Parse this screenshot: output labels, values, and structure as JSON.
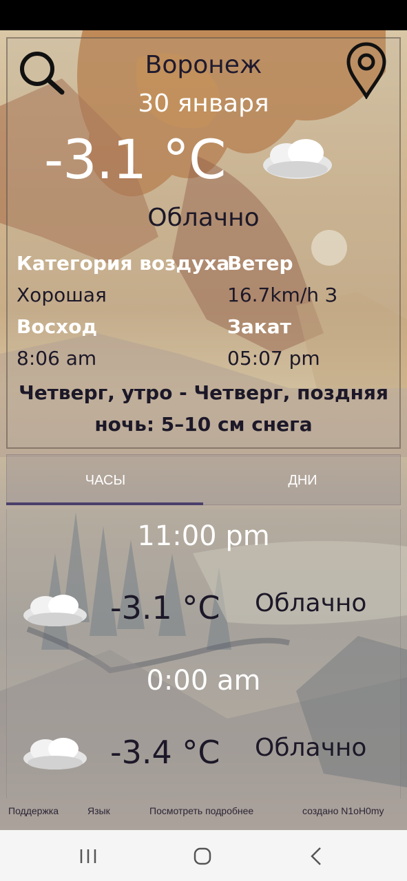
{
  "header": {
    "city": "Воронеж",
    "date": "30 января"
  },
  "current": {
    "temperature": "-3.1 °C",
    "condition": "Облачно"
  },
  "details": {
    "air_label": "Категория воздуха",
    "air_value": "Хорошая",
    "wind_label": "Ветер",
    "wind_value": "16.7km/h З",
    "sunrise_label": "Восход",
    "sunrise_value": "8:06 am",
    "sunset_label": "Закат",
    "sunset_value": "05:07 pm"
  },
  "forecast_note_line1": "Четверг, утро - Четверг, поздняя",
  "forecast_note_line2": "ночь: 5–10 см снега",
  "tabs": [
    {
      "label": "ЧАСЫ",
      "active": true
    },
    {
      "label": "ДНИ",
      "active": false
    }
  ],
  "hours": [
    {
      "time": "11:00 pm",
      "temperature": "-3.1 °C",
      "condition": "Облачно",
      "icon": "cloud-icon"
    },
    {
      "time": "0:00 am",
      "temperature": "-3.4 °C",
      "condition": "Облачно",
      "icon": "cloud-icon"
    }
  ],
  "footer": {
    "support": "Поддержка",
    "language": "Язык",
    "more": "Посмотреть подробнее",
    "credit": "создано N1oH0my"
  },
  "nav": {
    "recent": "recent-apps-icon",
    "home": "home-icon",
    "back": "back-icon"
  },
  "colors": {
    "dark_text": "#1c1828",
    "light_text": "#ffffff",
    "tab_indicator": "#4b3f6a"
  }
}
